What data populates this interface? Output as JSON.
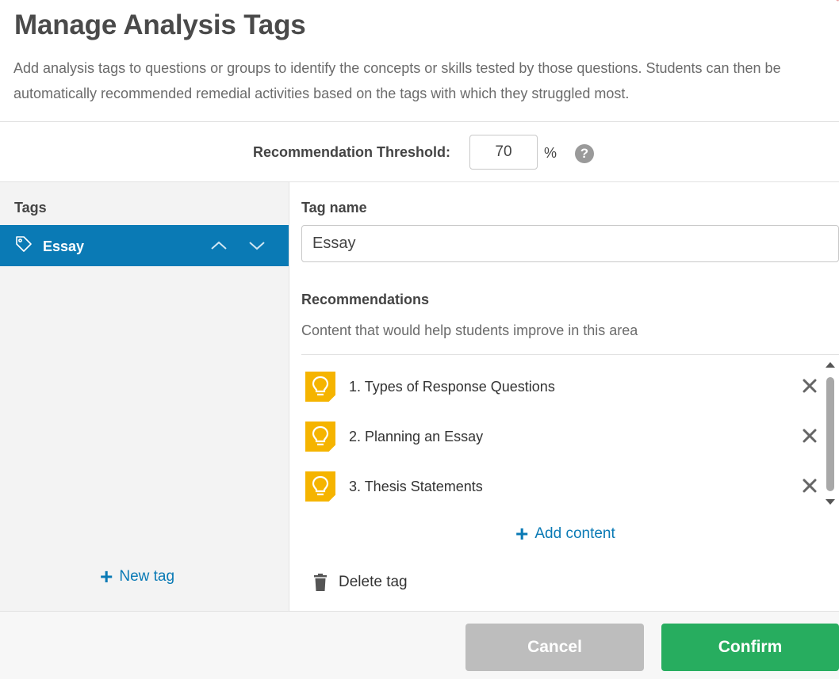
{
  "header": {
    "title": "Manage Analysis Tags",
    "description": "Add analysis tags to questions or groups to identify the concepts or skills tested by those questions. Students can then be automatically recommended remedial activities based on the tags with which they struggled most."
  },
  "threshold": {
    "label": "Recommendation Threshold:",
    "value": "70",
    "unit": "%",
    "help_icon": "question-circle-icon"
  },
  "sidebar": {
    "heading": "Tags",
    "tags": [
      {
        "label": "Essay",
        "icon": "tag-icon",
        "selected": true
      }
    ],
    "new_tag_label": "New tag"
  },
  "detail": {
    "tag_name_label": "Tag name",
    "tag_name_value": "Essay",
    "recommendations_label": "Recommendations",
    "recommendations_subtitle": "Content that would help students improve in this area",
    "recommendations": [
      {
        "label": "1. Types of Response Questions",
        "icon": "lightbulb-icon"
      },
      {
        "label": "2. Planning an Essay",
        "icon": "lightbulb-icon"
      },
      {
        "label": "3. Thesis Statements",
        "icon": "lightbulb-icon"
      }
    ],
    "add_content_label": "Add content",
    "delete_tag_label": "Delete tag"
  },
  "footer": {
    "cancel_label": "Cancel",
    "confirm_label": "Confirm"
  },
  "colors": {
    "accent": "#0a7ab5",
    "confirm": "#27ad5f",
    "cancel": "#bdbdbd",
    "bulb": "#f5b400"
  }
}
